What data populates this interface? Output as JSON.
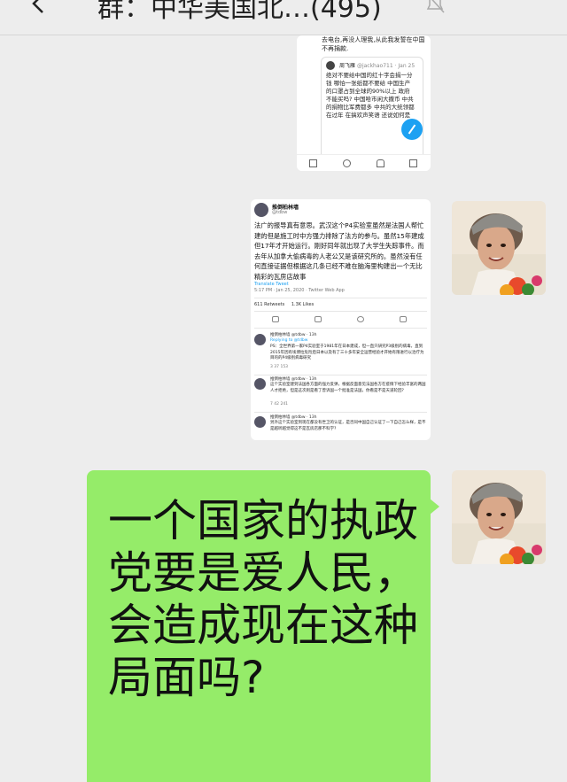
{
  "header": {
    "title": "群：中华美国北…(495)",
    "back_icon": "chevron-left-icon",
    "mute_icon": "bell-off-icon"
  },
  "messages": [
    {
      "type": "image",
      "content": {
        "top_text": "去电台,再没人理我,从此我发誓在中国不再捐款.",
        "quoted": {
          "name": "周飞雁",
          "handle": "@jackhao711 · Jan 25",
          "text": "绝对不要给中国的红十字会捐一分钱 哪怕一张纸都不要给 中国生产的口罩占到全球的90%以上 政府不能买吗? 中国哈市闲大撒币 中共的捐物比军费都多 中共的大统领都在过年 在搞欢声笑语 还说如何是"
        }
      }
    },
    {
      "type": "image",
      "content": {
        "name": "推倒柏林墙",
        "handle": "@tdbw",
        "text": "法广的报导真有意思。武汉这个P4实验室虽然是法国人帮忙建的但是施工时中方强力排除了法方的参与。虽然15年建成但17年才开始运行。刚好同年就出现了大学生失踪事件。而去年从加拿大偷病毒的人老公又是该研究所的。虽然没有任何直接证据但根据这几条已经不难在脑海里构建出一个无比精彩的瓦房店故事",
        "translate": "Translate Tweet",
        "meta": "5:17 PM · Jan 25, 2020 · Twitter Web App",
        "retweets": "611 Retweets",
        "likes": "1.3K Likes",
        "replies": [
          {
            "head": "推倒柏林墙 @tdbw · 13h",
            "replying": "Replying to @tdbw",
            "text": "PS：全世界第一家P4实验室于1981年在日本建成，但一直只研究P3级别的病毒，直到2015年因有埃博拉危险后日本以及有了三十多年安全运营经验才开始有限进行以治疗为目的的P4级别病毒研究",
            "counts": "3    37    153"
          },
          {
            "head": "推倒柏林墙 @tdbw · 13h",
            "text": "这个实验室建到法国各方面的强力反弹，根据反面意见法国各方在疫情下经验丰富的两国人才拒绝，但是这次则是看了曾诉国一个批准是法国，你看是不是天道轮回?",
            "counts": "7    42    241"
          },
          {
            "head": "推倒柏林墙 @tdbw · 13h",
            "text": "另外这个实验室到现在都没有世卫的认证，是否同中国自己认证了一下自己怎么样，是不是越听越觉得这不是瓦房店那不科学?",
            "counts": ""
          }
        ]
      }
    },
    {
      "type": "text",
      "content": "一个国家的执政党要是爱人民，会造成现在这种局面吗?"
    }
  ],
  "colors": {
    "bubble": "#95ec69",
    "background": "#ededed",
    "twitter_blue": "#1da1f2"
  }
}
